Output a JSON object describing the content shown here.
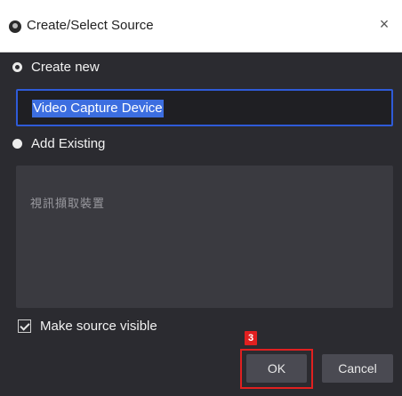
{
  "window": {
    "title": "Create/Select Source",
    "close_glyph": "×"
  },
  "create_new": {
    "label": "Create new",
    "name_value": "Video Capture Device"
  },
  "add_existing": {
    "label": "Add Existing",
    "items": [
      "視訊擷取裝置"
    ]
  },
  "make_visible": {
    "label": "Make source visible",
    "checked": true
  },
  "annotation": {
    "step": "3"
  },
  "buttons": {
    "ok": "OK",
    "cancel": "Cancel"
  },
  "colors": {
    "dialog_bg": "#2b2b30",
    "input_focus": "#2f5bd8",
    "selection": "#3c6ee0",
    "annotation_red": "#e02020"
  }
}
